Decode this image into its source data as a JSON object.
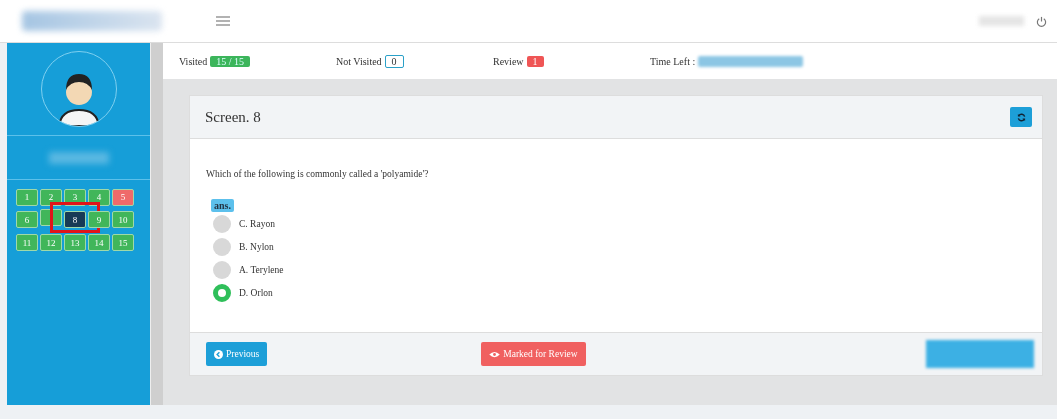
{
  "stats": [
    {
      "label": "Visited",
      "value": "15 / 15",
      "kind": "visited"
    },
    {
      "label": "Not Visited",
      "value": "0",
      "kind": "not_visited"
    },
    {
      "label": "Review",
      "value": "1",
      "kind": "review"
    }
  ],
  "time_left": {
    "label": "Time Left :"
  },
  "palette": [
    {
      "label": "1",
      "color": "#41b65a",
      "selected": false
    },
    {
      "label": "2",
      "color": "#41b65a",
      "selected": false
    },
    {
      "label": "3",
      "color": "#41b65a",
      "selected": false
    },
    {
      "label": "4",
      "color": "#41b65a",
      "selected": false
    },
    {
      "label": "5",
      "color": "#ef6a6a",
      "selected": false
    },
    {
      "label": "6",
      "color": "#41b65a",
      "selected": false
    },
    {
      "color": "#41b65a",
      "selected": false
    },
    {
      "label": "8",
      "color": "#173a55",
      "selected": true
    },
    {
      "label": "9",
      "color": "#41b65a",
      "selected": false
    },
    {
      "label": "10",
      "color": "#41b65a",
      "selected": false
    },
    {
      "label": "11",
      "color": "#41b65a",
      "selected": false
    },
    {
      "label": "12",
      "color": "#41b65a",
      "selected": false
    },
    {
      "label": "13",
      "color": "#41b65a",
      "selected": false
    },
    {
      "label": "14",
      "color": "#41b65a",
      "selected": false
    },
    {
      "label": "15",
      "color": "#41b65a",
      "selected": false
    }
  ],
  "question": {
    "title": "Screen. 8",
    "text": "Which of the following is commonly called a 'polyamide'?",
    "answer_tag": "ans.",
    "options": [
      {
        "label": "C. Rayon",
        "selected": false
      },
      {
        "label": "B. Nylon",
        "selected": false
      },
      {
        "label": "A. Terylene",
        "selected": false
      },
      {
        "label": "D. Orlon",
        "selected": true
      }
    ]
  },
  "buttons": {
    "previous": "Previous",
    "review": "Marked for Review"
  }
}
